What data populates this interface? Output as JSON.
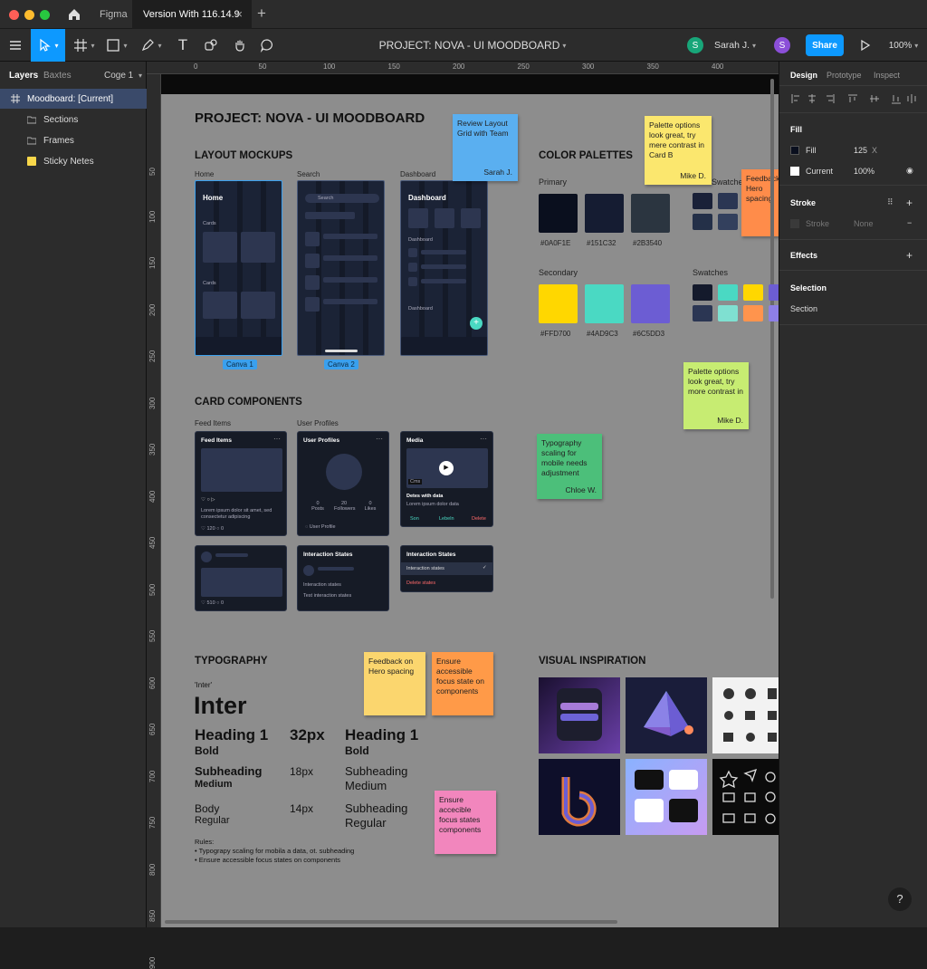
{
  "titlebar": {
    "tabs": [
      "Figma",
      "Version With 116.14.9"
    ],
    "close_icon": "×",
    "new_tab": "+",
    "traffic_colors": [
      "#ff5f57",
      "#febc2e",
      "#28c840"
    ]
  },
  "toolbar": {
    "file_title": "PROJECT: NOVA - UI MOODBOARD",
    "user_name": "Sarah J.",
    "avatar_initial": "S",
    "avatar2_initial": "S",
    "share_label": "Share",
    "zoom": "100%",
    "accent": "#0d99ff"
  },
  "left_panel": {
    "tabs": [
      "Layers",
      "Baxtes"
    ],
    "page": "Coge 1",
    "layers": [
      {
        "label": "Moodboard: [Current]",
        "icon": "frame-icon"
      },
      {
        "label": "Sections",
        "icon": "folder-icon"
      },
      {
        "label": "Frames",
        "icon": "folder-icon"
      },
      {
        "label": "Sticky Netes",
        "icon": "sticky-icon"
      }
    ]
  },
  "rulers": {
    "top": [
      "0",
      "50",
      "100",
      "150",
      "200",
      "250",
      "300",
      "350",
      "400"
    ],
    "left": [
      "50",
      "100",
      "150",
      "200",
      "250",
      "300",
      "350",
      "400",
      "450",
      "500",
      "550",
      "600",
      "650",
      "700",
      "750",
      "800",
      "850",
      "900"
    ]
  },
  "board": {
    "title": "PROJECT: NOVA - UI MOODBOARD",
    "layout": {
      "heading": "LAYOUT MOCKUPS",
      "labels": [
        "Home",
        "Search",
        "Dashboard"
      ],
      "screen_titles": [
        "Home",
        "",
        "Dashboard"
      ],
      "canvas_labels": [
        "Canva 1",
        "Canva 2"
      ],
      "home_rows": [
        "Cards",
        "Cards"
      ],
      "search_placeholder": "Search",
      "dash_rows": [
        "Dashboard",
        "Dashboard"
      ]
    },
    "cards": {
      "heading": "CARD COMPONENTS",
      "labels": [
        "Feed Items",
        "User Profiles"
      ],
      "feed_title": "Feed Items",
      "feed_text": "Lorem ipsum dolor sit amet, sed consectetur adipiscing",
      "feed_stats": [
        "120",
        "0"
      ],
      "profile_title": "User Profiles",
      "profile_stats": [
        {
          "v": "0",
          "l": "Posts"
        },
        {
          "v": "20",
          "l": "Followers"
        },
        {
          "v": "0",
          "l": "Likes"
        }
      ],
      "profile_footer": "User Profile",
      "media_title": "Media",
      "media_tag": "Cms",
      "media_sub": "Detes with data",
      "media_subtext": "Lorem ipsum dolor data",
      "media_actions": [
        "Son",
        "Lebeln",
        "Delete"
      ],
      "small_stats": [
        "510",
        "0"
      ],
      "state_title1": "Interaction States",
      "state_rows1": [
        "Interaction states",
        "Test interaction states"
      ],
      "state_title2": "Interaction States",
      "state_rows2": [
        "Interaction states",
        "Delete states"
      ]
    },
    "palettes": {
      "heading": "COLOR PALETTES",
      "primary_label": "Primary",
      "primary": [
        {
          "hex": "#0A0F1E",
          "label": "#0A0F1E"
        },
        {
          "hex": "#151C32",
          "label": "#151C32"
        },
        {
          "hex": "#2B3540",
          "label": "#2B3540"
        }
      ],
      "secondary_label": "Secondary",
      "secondary": [
        {
          "hex": "#FFD700",
          "label": "#FFD700"
        },
        {
          "hex": "#4AD9C3",
          "label": "#4AD9C3"
        },
        {
          "hex": "#6C5DD3",
          "label": "#6C5DD3"
        }
      ],
      "swatches_label_1": "Swatches",
      "swatches_label_2": "Swatches",
      "swatches_top": [
        "#1a2138",
        "#2b3653",
        "#243048",
        "#33405d"
      ],
      "swatches_bottom": [
        "#141a2c",
        "#4ad9c3",
        "#ffd700",
        "#6c5dd3",
        "#2b3653",
        "#7fe0d1",
        "#ff944d",
        "#8d7fe6"
      ]
    },
    "typography": {
      "heading": "TYPOGRAPHY",
      "font_tag": "'Inter'",
      "font_name": "Inter",
      "h1": "Heading 1",
      "h1_weight": "Bold",
      "h1_size": "32px",
      "h1b": "Heading 1",
      "h1b_weight": "Bold",
      "sub": "Subheading",
      "sub_weight": "Medium",
      "sub_size": "18px",
      "subb": "Subheading",
      "subb_weight": "Medium",
      "body": "Body",
      "body_weight": "Regular",
      "body_size": "14px",
      "subc": "Subheading",
      "subc_weight": "Regular",
      "rules_title": "Rules:",
      "rules": [
        "Typograpy scaling for mobila a data, ot. subheading",
        "Ensure accessible focus states on components"
      ]
    },
    "inspiration": {
      "heading": "VISUAL INSPIRATION"
    },
    "stickies": [
      {
        "text": "Review Layout Grid with Team",
        "author": "Sarah J.",
        "color": "#5aaff0"
      },
      {
        "text": "Palette options look great, try mere contrast in Card B",
        "author": "Mike D.",
        "color": "#fbe76e"
      },
      {
        "text": "Feedback on Hero spacing",
        "author": "",
        "color": "#ff8c4a"
      },
      {
        "text": "Palette options look great, try more contrast in",
        "author": "Mike D.",
        "color": "#c7ec72"
      },
      {
        "text": "Typography scaling for mobile needs adjustment",
        "author": "Chloe W.",
        "color": "#4cbf7a"
      },
      {
        "text": "Feedback on Hero spacing",
        "author": "",
        "color": "#fbd66e"
      },
      {
        "text": "Ensure accessible focus state on components",
        "author": "",
        "color": "#ff9a48"
      },
      {
        "text": "Ensure accecible focus states components",
        "author": "",
        "color": "#f286bd"
      }
    ]
  },
  "right_panel": {
    "tabs": [
      "Design",
      "Prototype",
      "Inspect"
    ],
    "fill_heading": "Fill",
    "fill_rows": [
      {
        "name": "Fill",
        "value": "125",
        "extra": "X"
      },
      {
        "name": "Current",
        "value": "100%",
        "extra": ""
      }
    ],
    "stroke_heading": "Stroke",
    "stroke_row": {
      "name": "Stroke",
      "value": "None"
    },
    "effects_heading": "Effects",
    "selection_heading": "Selection",
    "selection_value": "Section",
    "help": "?"
  }
}
